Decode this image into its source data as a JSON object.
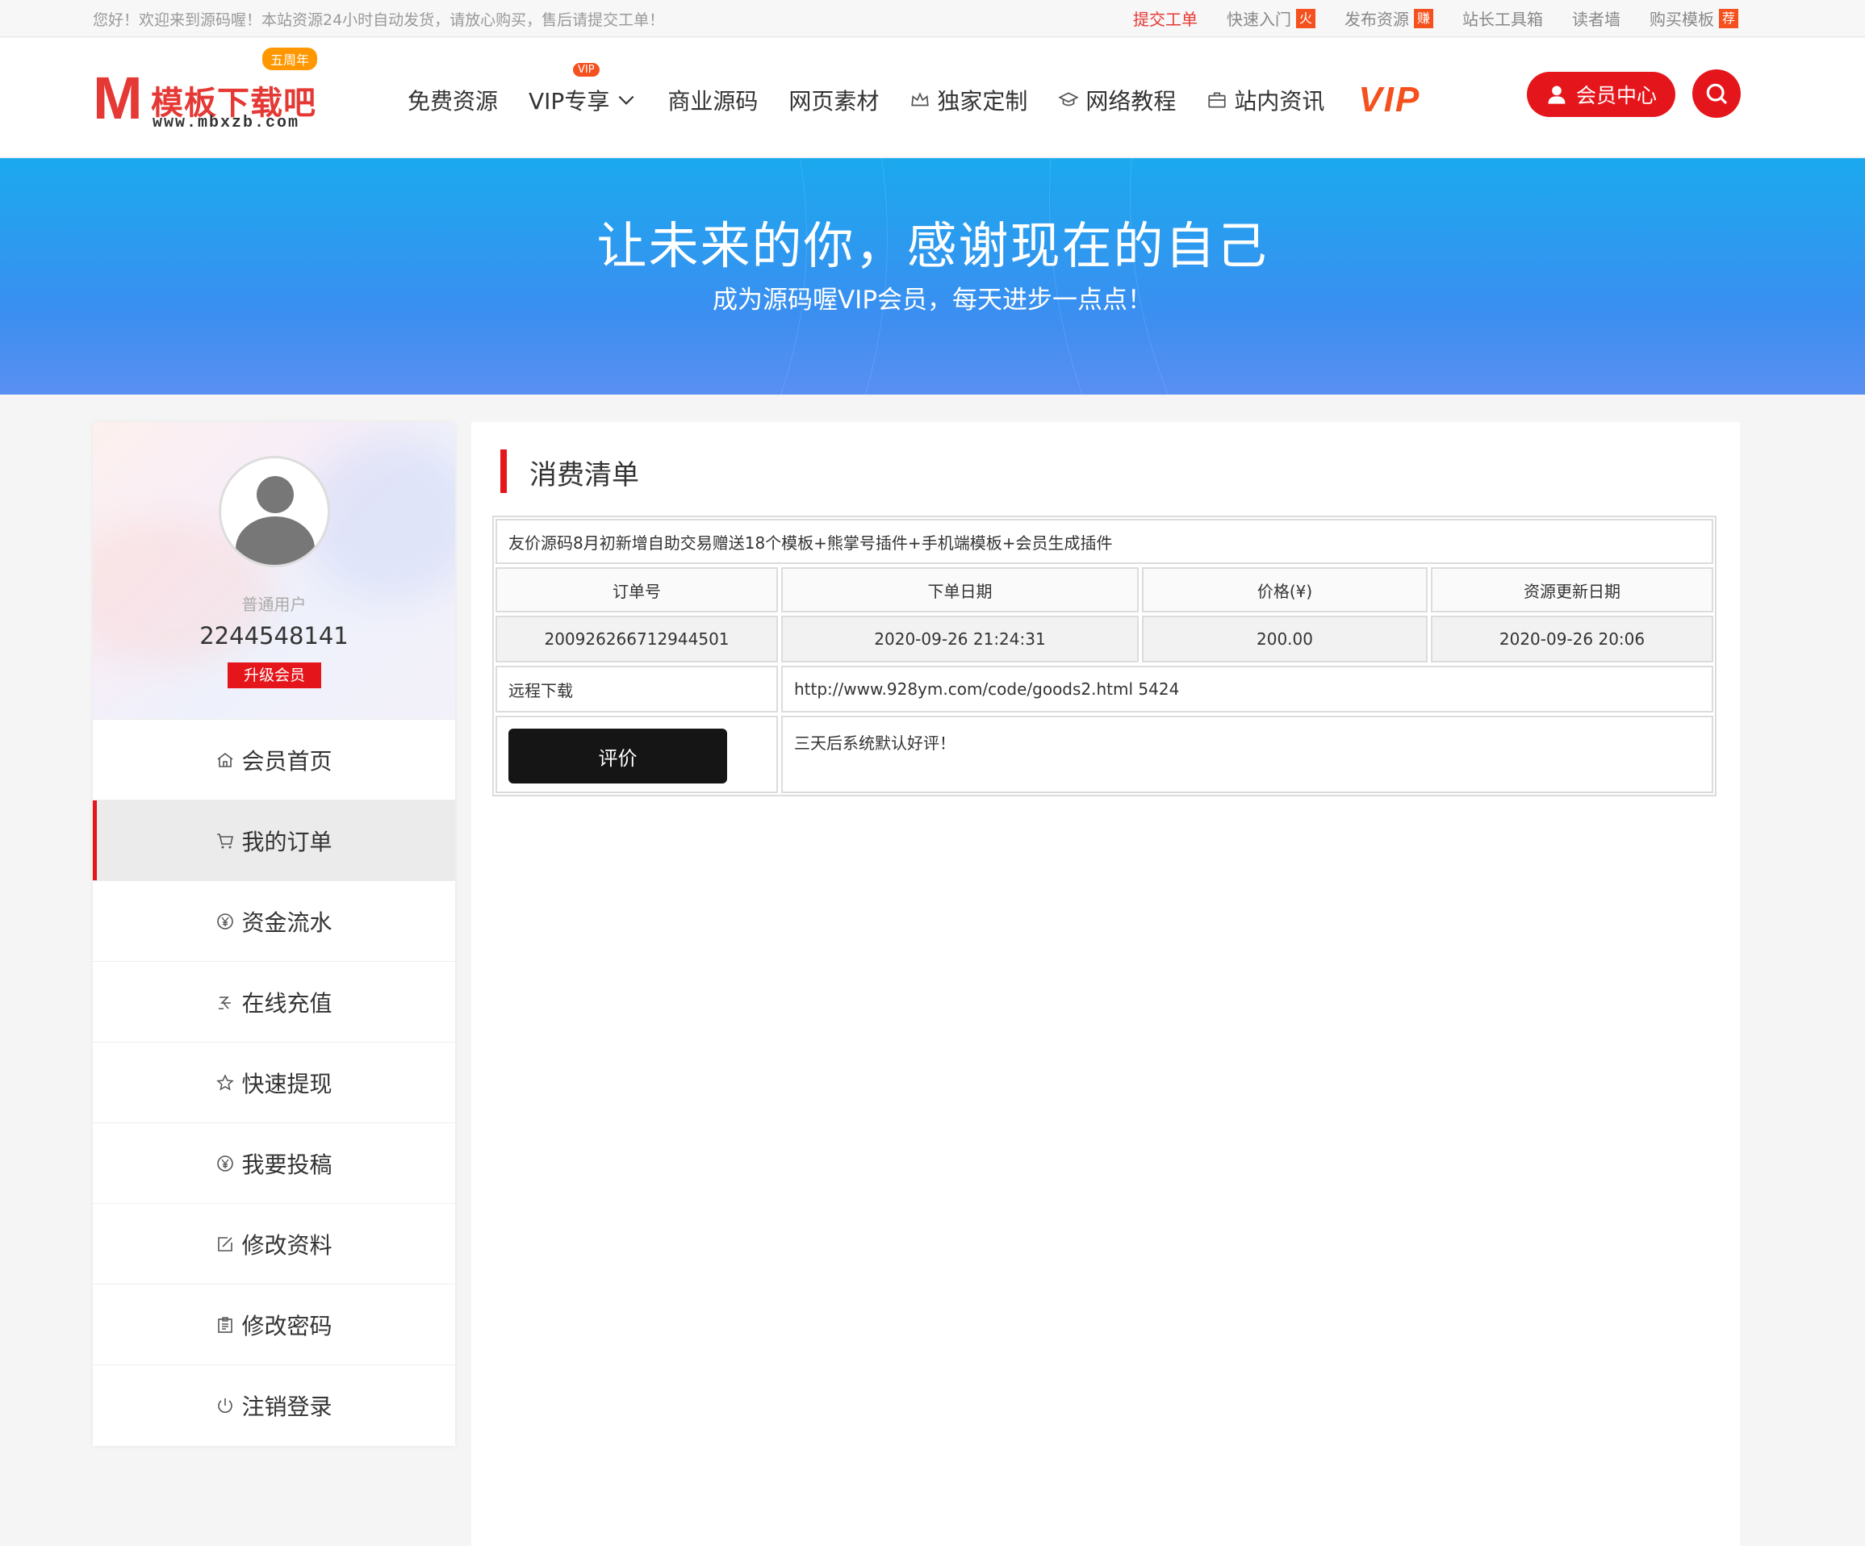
{
  "topbar": {
    "welcome": "您好！欢迎来到源码喔！本站资源24小时自动发货，请放心购买，售后请提交工单！",
    "links": [
      {
        "label": "提交工单",
        "badge": "",
        "hot": true
      },
      {
        "label": "快速入门",
        "badge": "火",
        "hot": false
      },
      {
        "label": "发布资源",
        "badge": "赚",
        "hot": false
      },
      {
        "label": "站长工具箱",
        "badge": "",
        "hot": false
      },
      {
        "label": "读者墙",
        "badge": "",
        "hot": false
      },
      {
        "label": "购买模板",
        "badge": "荐",
        "hot": false
      }
    ]
  },
  "logo": {
    "letter": "M",
    "name": "模板下载吧",
    "url": "www.mbxzb.com",
    "anniversary": "五周年"
  },
  "nav": {
    "items": [
      {
        "label": "免费资源",
        "icon": ""
      },
      {
        "label": "VIP专享",
        "icon": "chevron-down-icon",
        "badge": "VIP"
      },
      {
        "label": "商业源码",
        "icon": ""
      },
      {
        "label": "网页素材",
        "icon": ""
      },
      {
        "label": "独家定制",
        "icon": "crown-icon"
      },
      {
        "label": "网络教程",
        "icon": "graduation-cap-icon"
      },
      {
        "label": "站内资讯",
        "icon": "briefcase-icon"
      }
    ],
    "vip_logo": "VIP",
    "member_center": "会员中心"
  },
  "banner": {
    "title": "让未来的你，感谢现在的自己",
    "subtitle": "成为源码喔VIP会员，每天进步一点点！"
  },
  "profile": {
    "role": "普通用户",
    "user_id": "2244548141",
    "upgrade_label": "升级会员"
  },
  "menu": [
    {
      "label": "会员首页",
      "icon": "home-icon",
      "active": false
    },
    {
      "label": "我的订单",
      "icon": "cart-icon",
      "active": true
    },
    {
      "label": "资金流水",
      "icon": "yen-circle-icon",
      "active": false
    },
    {
      "label": "在线充值",
      "icon": "yen-sign-icon",
      "active": false
    },
    {
      "label": "快速提现",
      "icon": "star-icon",
      "active": false
    },
    {
      "label": "我要投稿",
      "icon": "yen-circle-icon",
      "active": false
    },
    {
      "label": "修改资料",
      "icon": "edit-icon",
      "active": false
    },
    {
      "label": "修改密码",
      "icon": "clipboard-icon",
      "active": false
    },
    {
      "label": "注销登录",
      "icon": "power-icon",
      "active": false
    }
  ],
  "main": {
    "title": "消费清单",
    "order": {
      "product": "友价源码8月初新增自助交易赠送18个模板+熊掌号插件+手机端模板+会员生成插件",
      "headers": [
        "订单号",
        "下单日期",
        "价格(¥)",
        "资源更新日期"
      ],
      "values": [
        "200926266712944501",
        "2020-09-26 21:24:31",
        "200.00",
        "2020-09-26 20:06"
      ],
      "download_label": "远程下载",
      "download_value": "http://www.928ym.com/code/goods2.html 5424",
      "review_button": "评价",
      "review_note": "三天后系统默认好评！"
    }
  },
  "colors": {
    "accent": "#e5161b",
    "banner_top": "#1ba9ee",
    "banner_bottom": "#5a8ff2",
    "badge_orange": "#f4511e"
  }
}
